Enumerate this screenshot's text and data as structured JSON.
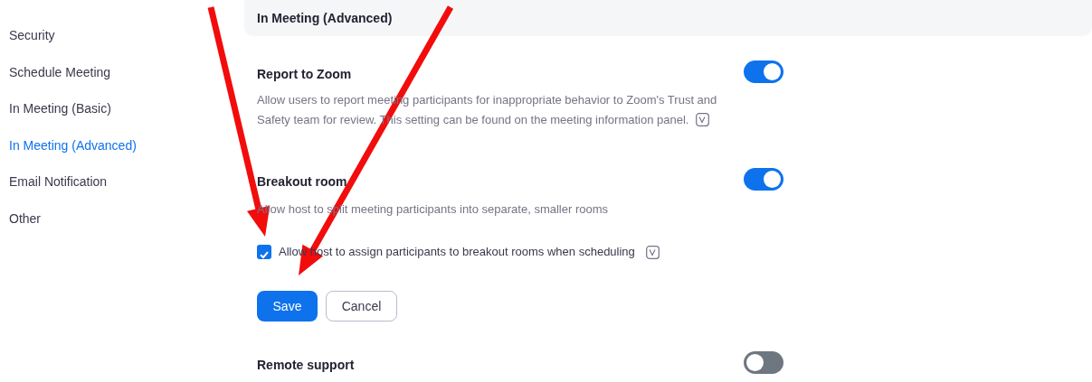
{
  "sidebar": {
    "items": [
      {
        "label": "Security",
        "selected": false
      },
      {
        "label": "Schedule Meeting",
        "selected": false
      },
      {
        "label": "In Meeting (Basic)",
        "selected": false
      },
      {
        "label": "In Meeting (Advanced)",
        "selected": true
      },
      {
        "label": "Email Notification",
        "selected": false
      },
      {
        "label": "Other",
        "selected": false
      }
    ]
  },
  "section": {
    "title": "In Meeting (Advanced)"
  },
  "settings": [
    {
      "title": "Report to Zoom",
      "on": true,
      "description": "Allow users to report meeting participants for inappropriate behavior to Zoom's Trust and Safety team for review. This setting can be found on the meeting information panel."
    },
    {
      "title": "Breakout room",
      "on": true,
      "description": "Allow host to split meeting participants into separate, smaller rooms",
      "option": {
        "label": "Allow host to assign participants to breakout rooms when scheduling",
        "checked": true
      },
      "buttons": [
        "Save",
        "Cancel"
      ]
    },
    {
      "title": "Remote support",
      "on": false
    }
  ],
  "annotations": [
    {
      "kind": "arrow"
    },
    {
      "kind": "arrow"
    }
  ]
}
